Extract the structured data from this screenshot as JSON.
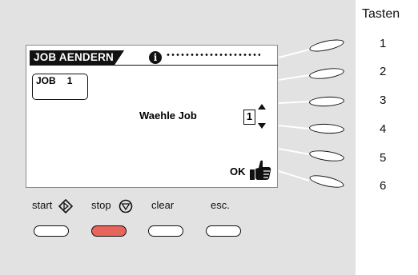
{
  "display": {
    "title": "JOB AENDERN",
    "job_label": "JOB",
    "job_number": "1",
    "prompt": "Waehle Job",
    "value": "1",
    "ok_label": "OK",
    "info_icon": "i"
  },
  "buttons": {
    "start_label": "start",
    "stop_label": "stop",
    "clear_label": "clear",
    "esc_label": "esc."
  },
  "soft_keys": {
    "title": "Tasten",
    "numbers": [
      "1",
      "2",
      "3",
      "4",
      "5",
      "6"
    ]
  },
  "colors": {
    "panel": "#e2e2e2",
    "stop_button": "#e7655a"
  },
  "icons": [
    "info-icon",
    "arrow-up-icon",
    "arrow-down-icon",
    "thumbs-up-icon",
    "start-icon",
    "stop-icon"
  ]
}
